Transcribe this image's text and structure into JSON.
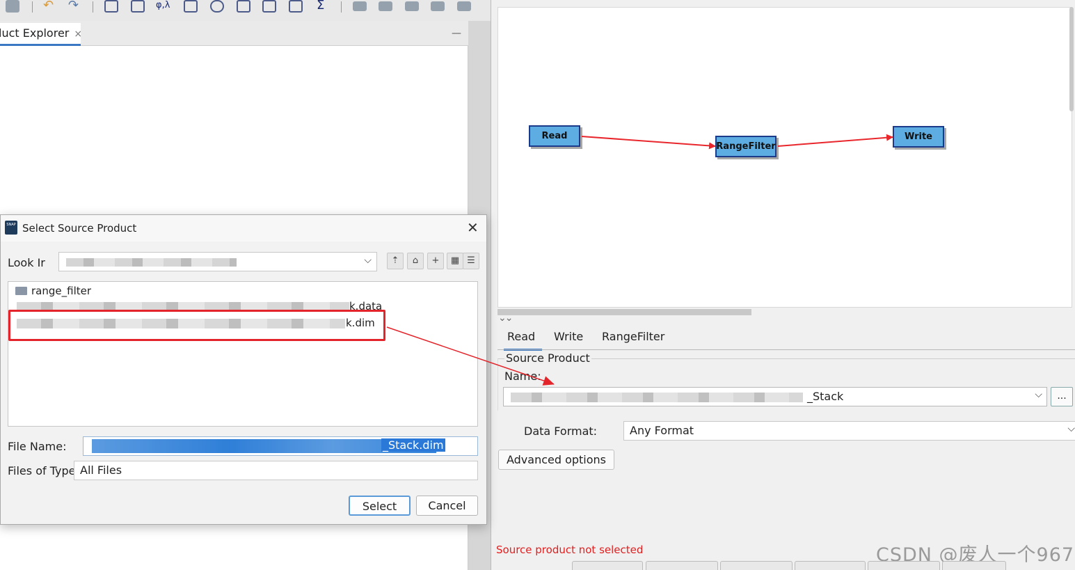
{
  "toolbar": {
    "icons": [
      "save-icon",
      "undo-icon",
      "redo-icon",
      "chart-icon",
      "edit-icon",
      "phi-lambda-icon",
      "flask-icon",
      "globe-icon",
      "spectrum-icon",
      "profile-icon",
      "scatter-icon",
      "sigma-icon",
      "tool-icon-1",
      "tool-icon-2",
      "tool-icon-3",
      "tool-icon-4",
      "tool-icon-5"
    ],
    "phi_lambda": "φ,λ",
    "sigma": "Σ"
  },
  "explorer": {
    "tab_label": "luct Explorer",
    "close_glyph": "×",
    "minimize_glyph": "—"
  },
  "graph": {
    "nodes": [
      {
        "id": "read",
        "label": "Read"
      },
      {
        "id": "rangefilter",
        "label": "RangeFilter"
      },
      {
        "id": "write",
        "label": "Write"
      }
    ],
    "edge_color": "#e8262b",
    "node_color": "#5dade2"
  },
  "props": {
    "collapse_glyph": "⌄⌄",
    "tabs": [
      {
        "label": "Read",
        "active": true
      },
      {
        "label": "Write",
        "active": false
      },
      {
        "label": "RangeFilter",
        "active": false
      }
    ],
    "source_product_legend": "Source Product",
    "name_label": "Name:",
    "name_value": "_Stack",
    "browse_label": "...",
    "data_format_label": "Data Format:",
    "data_format_value": "Any Format",
    "advanced_label": "Advanced options",
    "status_text": "Source product not selected",
    "watermark": "CSDN @废人一个967",
    "dropdown_glyph": "⌵"
  },
  "dialog": {
    "title": "Select Source Product",
    "icon_text": "SNAP",
    "close_glyph": "✕",
    "look_in_label": "Look In:",
    "look_in_visible": "Look Ir",
    "nav_buttons": [
      "up-folder-icon",
      "home-icon",
      "new-folder-icon",
      "list-view-icon",
      "details-view-icon"
    ],
    "files": [
      {
        "name": "range_filter",
        "type": "folder"
      },
      {
        "name": "k.data",
        "type": "file"
      },
      {
        "name": "k.dim",
        "type": "file"
      }
    ],
    "file_name_label": "File Name:",
    "file_name_value": "_Stack.dim",
    "files_of_type_label": "Files of Type:",
    "files_of_type_value": "All Files",
    "select_label": "Select",
    "cancel_label": "Cancel"
  },
  "annotation_color": "#e3252b"
}
